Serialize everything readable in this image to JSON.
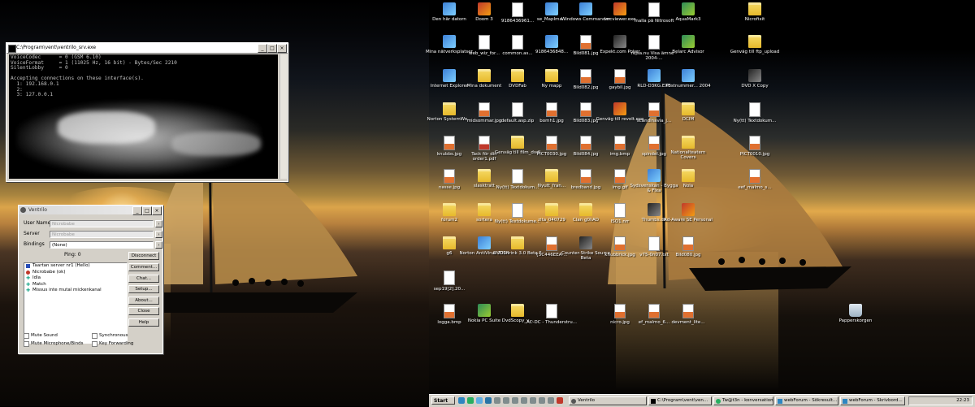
{
  "console": {
    "title": "C:\\Program\\vent\\ventrilo_srv.exe",
    "lines": "VoiceCodec      = 0 (GSM 6.10)\nVoiceFormat     = 1 (11025 Hz, 16 bit) - Bytes/Sec 2210\nSilentLobby     = 0\n\nAccepting connections on these interface(s).\n  1: 192.168.0.1\n  2: \n  3: 127.0.0.1"
  },
  "ventrilo": {
    "title": "Ventrilo",
    "user_name_label": "User Name",
    "user_name_value": "Nicrobabe",
    "server_label": "Server",
    "server_value": "Nicrobabe",
    "bindings_label": "Bindings",
    "bindings_value": "(None)",
    "ping_label": "Ping: 0",
    "buttons": [
      "Disconnect",
      "Comment...",
      "Chat...",
      "Setup...",
      "About...",
      "Close",
      "Help"
    ],
    "tree": [
      {
        "label": "Taartan server nr1 (Hello)",
        "icon": "server-icon"
      },
      {
        "label": "Nicrobabe (ok)",
        "icon": "user-icon"
      },
      {
        "label": "Idla",
        "icon": "channel-icon"
      },
      {
        "label": "Match",
        "icon": "channel-icon"
      },
      {
        "label": "Missus inte mutal mickenkanal",
        "icon": "channel-icon"
      }
    ],
    "checkboxes": {
      "mute_sound": "Mute Sound",
      "synchronous": "Synchronous",
      "mute_mic": "Mute Microphone/Binds",
      "key_forwarding": "Key Forwarding"
    }
  },
  "desktop_icons": [
    {
      "label": "Den här datorn",
      "icon": "computer-icon"
    },
    {
      "label": "Doom 3",
      "icon": "app-icon"
    },
    {
      "label": "9186436961...",
      "icon": "document-icon"
    },
    {
      "label": "se_MapIma...",
      "icon": "app-icon"
    },
    {
      "label": "Windows Commander",
      "icon": "app-icon"
    },
    {
      "label": "vncviewer.exe",
      "icon": "app-icon"
    },
    {
      "label": "malla på Nitrosoft",
      "icon": "app-icon"
    },
    {
      "label": "AquaMark3",
      "icon": "app-icon"
    },
    {
      "label": "Nicrofixit",
      "icon": "folder-icon"
    },
    {
      "label": "Mina nätverksplatser",
      "icon": "network-icon"
    },
    {
      "label": "web_wiz_for...",
      "icon": "document-icon"
    },
    {
      "label": "common.as...",
      "icon": "document-icon"
    },
    {
      "label": "9186436848...",
      "icon": "app-icon"
    },
    {
      "label": "Bild081.jpg",
      "icon": "image-icon"
    },
    {
      "label": "Expekt.com Poker",
      "icon": "app-icon"
    },
    {
      "label": "rejsa.nu Visa ämne - 2004-...",
      "icon": "app-icon"
    },
    {
      "label": "Belarc Advisor",
      "icon": "app-icon"
    },
    {
      "label": "Genväg till ftp_upload",
      "icon": "folder-icon"
    },
    {
      "label": "Internet Explorer",
      "icon": "browser-icon"
    },
    {
      "label": "Mina dokument",
      "icon": "folder-icon"
    },
    {
      "label": "DVDFab",
      "icon": "folder-icon"
    },
    {
      "label": "Ny mapp",
      "icon": "folder-icon"
    },
    {
      "label": "Bild082.jpg",
      "icon": "image-icon"
    },
    {
      "label": "gaybil.jpg",
      "icon": "image-icon"
    },
    {
      "label": "RLD-D3KG.EXE",
      "icon": "app-icon"
    },
    {
      "label": "Postnummer... 2004",
      "icon": "app-icon"
    },
    {
      "label": "DVD X Copy",
      "icon": "app-icon"
    },
    {
      "label": "Norton SystemWo...",
      "icon": "folder-icon"
    },
    {
      "label": "midsommar.jpg",
      "icon": "image-icon"
    },
    {
      "label": "default.asp.zip",
      "icon": "document-icon"
    },
    {
      "label": "bomh1.jpg",
      "icon": "image-icon"
    },
    {
      "label": "Bild083.jpg",
      "icon": "image-icon"
    },
    {
      "label": "Genväg till revolt.exe",
      "icon": "app-icon"
    },
    {
      "label": "scandinavia_j...",
      "icon": "image-icon"
    },
    {
      "label": "DCIM",
      "icon": "folder-icon"
    },
    {
      "label": "Ny(tt) Textdokum...",
      "icon": "document-icon"
    },
    {
      "label": "knubbs.jpg",
      "icon": "image-icon"
    },
    {
      "label": "Tack för din order1.pdf",
      "icon": "pdf-icon"
    },
    {
      "label": "Genväg till film_dvdl",
      "icon": "folder-icon"
    },
    {
      "label": "PICT0030.jpg",
      "icon": "image-icon"
    },
    {
      "label": "Bild084.jpg",
      "icon": "image-icon"
    },
    {
      "label": "img.bmp",
      "icon": "image-icon"
    },
    {
      "label": "spindel.jpg",
      "icon": "image-icon"
    },
    {
      "label": "Nationalteatern Covers",
      "icon": "folder-icon"
    },
    {
      "label": "PICT0010.jpg",
      "icon": "image-icon"
    },
    {
      "label": "nasse.jpg",
      "icon": "image-icon"
    },
    {
      "label": "slasktratt",
      "icon": "folder-icon"
    },
    {
      "label": "Ny(tt) Textdokum...",
      "icon": "document-icon"
    },
    {
      "label": "Nyutt_fran...",
      "icon": "folder-icon"
    },
    {
      "label": "bredband.jpg",
      "icon": "image-icon"
    },
    {
      "label": "img.gif",
      "icon": "image-icon"
    },
    {
      "label": "Sydsvenskan - Bygga & Fixa",
      "icon": "browser-icon"
    },
    {
      "label": "Nola",
      "icon": "folder-icon"
    },
    {
      "label": "eef_malmo_s...",
      "icon": "image-icon"
    },
    {
      "label": "forum2",
      "icon": "folder-icon"
    },
    {
      "label": "sortera",
      "icon": "folder-icon"
    },
    {
      "label": "Ny(tt) Textdokume...",
      "icon": "document-icon"
    },
    {
      "label": "zita_040729",
      "icon": "folder-icon"
    },
    {
      "label": "Clan g0liAD",
      "icon": "folder-icon"
    },
    {
      "label": "ISO1.nrr",
      "icon": "document-icon"
    },
    {
      "label": "Thumbs.db",
      "icon": "document-icon"
    },
    {
      "label": "Ad-Aware SE Personal",
      "icon": "app-icon"
    },
    {
      "label": "g6",
      "icon": "folder-icon"
    },
    {
      "label": "Norton AntiVirus 2004",
      "icon": "app-icon"
    },
    {
      "label": "DVDShrink 3.0 Beta 5",
      "icon": "folder-icon"
    },
    {
      "label": "{5C446EEA-...",
      "icon": "image-icon"
    },
    {
      "label": "Counter-Strike Source Beta",
      "icon": "app-icon"
    },
    {
      "label": "knubbrick.jpg",
      "icon": "image-icon"
    },
    {
      "label": "v75-0n07.txt",
      "icon": "document-icon"
    },
    {
      "label": "Bild080.jpg",
      "icon": "image-icon"
    },
    {
      "label": "sep19[2].20...",
      "icon": "document-icon"
    },
    {
      "label": "logga.bmp",
      "icon": "image-icon"
    },
    {
      "label": "Nokia PC Suite",
      "icon": "app-icon"
    },
    {
      "label": "DvdScopy_v...",
      "icon": "folder-icon"
    },
    {
      "label": "AC-DC - Thunderstru...",
      "icon": "document-icon"
    },
    {
      "label": "nicro.jpg",
      "icon": "image-icon"
    },
    {
      "label": "ef_malmo_6...",
      "icon": "image-icon"
    },
    {
      "label": "devment_lite...",
      "icon": "image-icon"
    },
    {
      "label": "Papperskorgen",
      "icon": "trash-icon"
    }
  ],
  "taskbar": {
    "start_label": "Start",
    "tasks": [
      {
        "label": "Ventrilo"
      },
      {
        "label": "C:\\Program\\vent\\ven..."
      },
      {
        "label": "Tw@t3n - konversation"
      },
      {
        "label": "webForum - Sökresult..."
      },
      {
        "label": "webForum - Skrivbord..."
      }
    ],
    "clock": "22:23"
  }
}
